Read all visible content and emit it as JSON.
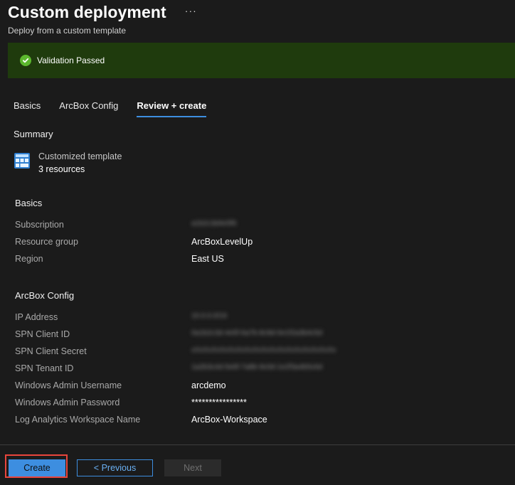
{
  "header": {
    "title": "Custom deployment",
    "more_label": "···",
    "subtitle": "Deploy from a custom template"
  },
  "banner": {
    "text": "Validation Passed",
    "status_color": "#5cb82e",
    "background_color": "#1f3b0d"
  },
  "tabs": [
    {
      "label": "Basics",
      "active": false
    },
    {
      "label": "ArcBox Config",
      "active": false
    },
    {
      "label": "Review + create",
      "active": true
    }
  ],
  "summary": {
    "heading": "Summary",
    "template_icon": "template-grid-icon",
    "template_name": "Customized template",
    "resource_count": "3 resources"
  },
  "basics": {
    "heading": "Basics",
    "rows": [
      {
        "label": "Subscription",
        "value": "a1b2c3d4e5f6"
      },
      {
        "label": "Resource group",
        "value": "ArcBoxLevelUp"
      },
      {
        "label": "Region",
        "value": "East US"
      }
    ]
  },
  "arcbox_config": {
    "heading": "ArcBox Config",
    "rows": [
      {
        "label": "IP Address",
        "value": "10.0.0.0/16"
      },
      {
        "label": "SPN Client ID",
        "value": "0a1b2c3d-4e5f-6a7b-8c9d-0e1f2a3b4c5d"
      },
      {
        "label": "SPN Client Secret",
        "value": "xXxXxXxXxXxXxXxXxXxXxXxXxXxXxXxXxXx"
      },
      {
        "label": "SPN Tenant ID",
        "value": "1a2b3c4d-5e6f-7a8b-9c0d-1e2f3a4b5c6d"
      },
      {
        "label": "Windows Admin Username",
        "value": "arcdemo"
      },
      {
        "label": "Windows Admin Password",
        "value": "****************"
      },
      {
        "label": "Log Analytics Workspace Name",
        "value": "ArcBox-Workspace"
      }
    ]
  },
  "footer": {
    "create_label": "Create",
    "previous_label": "< Previous",
    "next_label": "Next",
    "accent_color": "#3d8ee0",
    "highlight_color": "#e8453c"
  }
}
